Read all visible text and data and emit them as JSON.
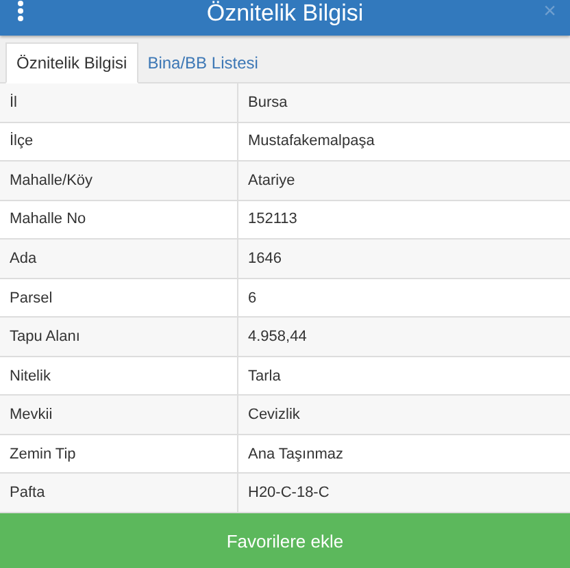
{
  "header": {
    "title": "Öznitelik Bilgisi",
    "close": "×"
  },
  "tabs": [
    {
      "label": "Öznitelik Bilgisi",
      "selected": true
    },
    {
      "label": "Bina/BB Listesi",
      "selected": false
    }
  ],
  "rows": [
    {
      "label": "İl",
      "value": "Bursa"
    },
    {
      "label": "İlçe",
      "value": "Mustafakemalpaşa"
    },
    {
      "label": "Mahalle/Köy",
      "value": "Atariye"
    },
    {
      "label": "Mahalle No",
      "value": "152113"
    },
    {
      "label": "Ada",
      "value": "1646"
    },
    {
      "label": "Parsel",
      "value": "6"
    },
    {
      "label": "Tapu Alanı",
      "value": "4.958,44"
    },
    {
      "label": "Nitelik",
      "value": "Tarla"
    },
    {
      "label": "Mevkii",
      "value": "Cevizlik"
    },
    {
      "label": "Zemin Tip",
      "value": "Ana Taşınmaz"
    },
    {
      "label": "Pafta",
      "value": "H20-C-18-C"
    }
  ],
  "action": "Favorilere ekle"
}
